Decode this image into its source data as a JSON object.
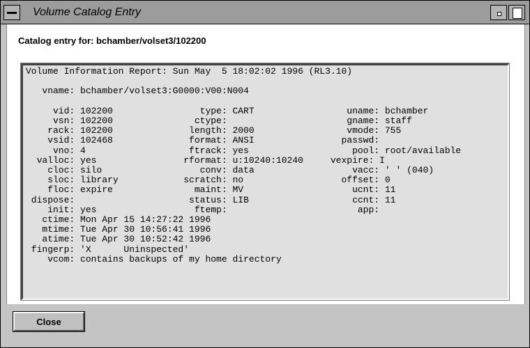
{
  "window": {
    "title": "Volume Catalog Entry"
  },
  "header": {
    "label": "Catalog entry for: bchamber/volset3/102200"
  },
  "report": {
    "lines": [
      "Volume Information Report: Sun May  5 18:02:02 1996 (RL3.10)",
      "",
      "   vname: bchamber/volset3:G0000:V00:N004",
      "",
      "     vid: 102200                type: CART                 uname: bchamber",
      "     vsn: 102200               ctype:                      gname: staff",
      "    rack: 102200              length: 2000                 vmode: 755",
      "    vsid: 102468              format: ANSI                passwd:",
      "     vno: 4                   ftrack: yes                   pool: root/available",
      "  valloc: yes                rformat: u:10240:10240     vexpire: I",
      "    cloc: silo                  conv: data                  vacc: ' ' (040)",
      "    sloc: library            scratch: no                  offset: 0",
      "    floc: expire               maint: MV                    ucnt: 11",
      " dispose:                     status: LIB                   ccnt: 11",
      "    init: yes                  ftemp:                        app:",
      "   ctime: Mon Apr 15 14:27:22 1996",
      "   mtime: Tue Apr 30 10:56:41 1996",
      "   atime: Tue Apr 30 10:52:42 1996",
      " fingerp: 'X      Uninspected'",
      "    vcom: contains backups of my home directory"
    ]
  },
  "footer": {
    "close_label": "Close"
  },
  "icons": {
    "window_menu": "window-menu-icon",
    "minimize": "minimize-icon",
    "maximize": "maximize-icon"
  }
}
